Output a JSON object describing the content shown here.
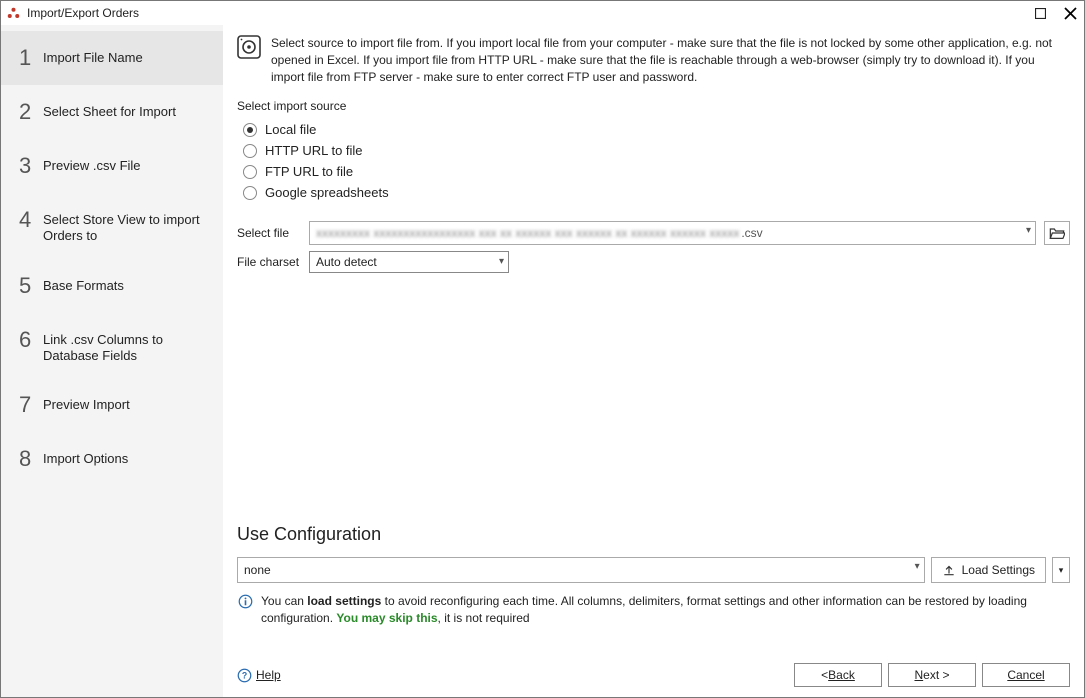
{
  "window": {
    "title": "Import/Export Orders"
  },
  "sidebar": {
    "steps": [
      {
        "num": "1",
        "label": "Import File Name"
      },
      {
        "num": "2",
        "label": "Select Sheet for Import"
      },
      {
        "num": "3",
        "label": "Preview .csv File"
      },
      {
        "num": "4",
        "label": "Select Store View to import Orders to"
      },
      {
        "num": "5",
        "label": "Base Formats"
      },
      {
        "num": "6",
        "label": "Link .csv Columns to Database Fields"
      },
      {
        "num": "7",
        "label": "Preview Import"
      },
      {
        "num": "8",
        "label": "Import Options"
      }
    ],
    "active_index": 0
  },
  "intro": {
    "text": "Select source to import file from. If you import local file from your computer - make sure that the file is not locked by some other application, e.g. not opened in Excel. If you import file from HTTP URL - make sure that the file is reachable through a web-browser (simply try to download it). If you import file from FTP server - make sure to enter correct FTP user and password."
  },
  "source": {
    "label": "Select import source",
    "options": [
      "Local file",
      "HTTP URL to file",
      "FTP URL to file",
      "Google spreadsheets"
    ],
    "selected_index": 0
  },
  "file": {
    "label": "Select file",
    "value_blur": "xxxxxxxxx xxxxxxxxxxxxxxxxx xxx xx  xxxxxx xxx xxxxxx   xx xxxxxx  xxxxxx xxxxx",
    "ext": ".csv"
  },
  "charset": {
    "label": "File charset",
    "value": "Auto detect"
  },
  "config": {
    "heading": "Use Configuration",
    "value": "none",
    "load_label": "Load Settings",
    "hint_prefix": "You can ",
    "hint_bold1": "load settings",
    "hint_mid": " to avoid reconfiguring each time. All columns, delimiters, format settings and other information can be restored by loading configuration. ",
    "hint_bold2": "You may skip this",
    "hint_suffix": ", it is not required"
  },
  "footer": {
    "help": "Help",
    "back": "Back",
    "next": "Next >",
    "cancel": "Cancel"
  }
}
